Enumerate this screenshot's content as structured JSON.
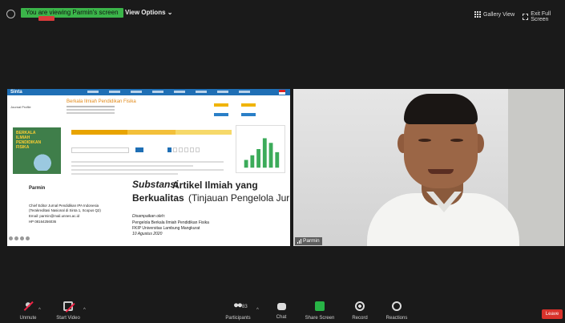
{
  "topbar": {
    "share_banner": "You are viewing Parmin's screen",
    "view_options": "View Options ⌄",
    "gallery_view": "Gallery View",
    "exit_full_screen": "Exit Full Screen"
  },
  "shared_screen": {
    "site_logo": "Sinta",
    "journal_profile": "Journal Profile",
    "journal_name": "Berkala Ilmiah Pendidikan Fisika",
    "cover_title": "BERKALA ILMIAH PENDIDIKAN FISIKA",
    "slide": {
      "presenter": "Parmin",
      "contact_1": "Chief Editor Jurnal Pendidikan IPA Indonesia",
      "contact_2": "(Terakreditasi Nasional di Sinta 1, Scopus Q2)",
      "contact_3": "Email: parmin@mail.unnes.ac.id",
      "contact_4": "HP 08164256036",
      "title_italic": "Substansi",
      "title_1": "Artikel Ilmiah yang",
      "title_2": "Berkualitas",
      "title_paren": "(Tinjauan Pengelola Jurnal)",
      "delivered_by": "Disampaikan oleh:",
      "delivered_to_1": "Pengelola Berkala Ilmiah Pendidikan Fisika",
      "delivered_to_2": "FKIP Universitas Lambung Mangkurat",
      "date": "10 Agustus 2020"
    }
  },
  "video_tile": {
    "participant_name": "Parmin"
  },
  "toolbar": {
    "unmute": "Unmute",
    "start_video": "Start Video",
    "participants": "Participants",
    "participants_count": "83",
    "chat": "Chat",
    "share_screen": "Share Screen",
    "record": "Record",
    "reactions": "Reactions",
    "leave": "Leave"
  }
}
